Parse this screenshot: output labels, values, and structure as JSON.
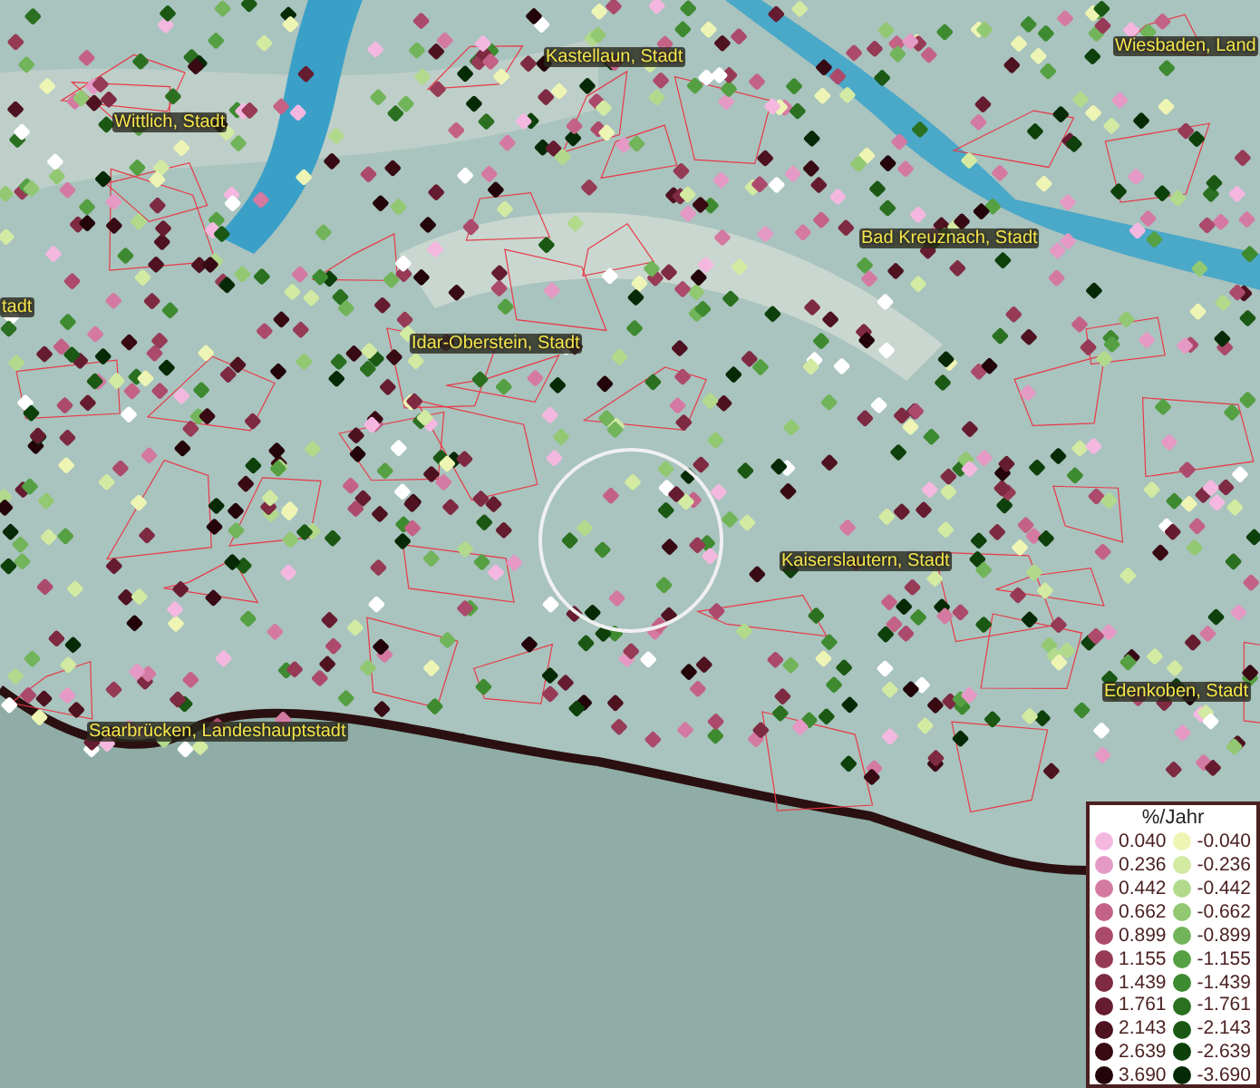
{
  "map": {
    "places": [
      {
        "name": "Kastellaun, Stadt"
      },
      {
        "name": "Wiesbaden, Land"
      },
      {
        "name": "Wittlich, Stadt"
      },
      {
        "name": "Bad Kreuznach, Stadt"
      },
      {
        "name": "tadt"
      },
      {
        "name": "Idar-Oberstein, Stadt"
      },
      {
        "name": "Kaiserslautern, Stadt"
      },
      {
        "name": "Edenkoben, Stadt"
      },
      {
        "name": "Saarbrücken, Landeshauptstadt"
      }
    ]
  },
  "legend": {
    "title": "%/Jahr",
    "rows": [
      {
        "positive": {
          "label": "0.040",
          "color": "#f4b8e0"
        },
        "negative": {
          "label": "-0.040",
          "color": "#eef5b4"
        }
      },
      {
        "positive": {
          "label": "0.236",
          "color": "#e49ac4"
        },
        "negative": {
          "label": "-0.236",
          "color": "#d2eaa2"
        }
      },
      {
        "positive": {
          "label": "0.442",
          "color": "#d47aa2"
        },
        "negative": {
          "label": "-0.442",
          "color": "#b2da8c"
        }
      },
      {
        "positive": {
          "label": "0.662",
          "color": "#c46286"
        },
        "negative": {
          "label": "-0.662",
          "color": "#92c872"
        }
      },
      {
        "positive": {
          "label": "0.899",
          "color": "#ac4a6c"
        },
        "negative": {
          "label": "-0.899",
          "color": "#72b45a"
        }
      },
      {
        "positive": {
          "label": "1.155",
          "color": "#963a56"
        },
        "negative": {
          "label": "-1.155",
          "color": "#55a042"
        }
      },
      {
        "positive": {
          "label": "1.439",
          "color": "#7e2a42"
        },
        "negative": {
          "label": "-1.439",
          "color": "#3e8a30"
        }
      },
      {
        "positive": {
          "label": "1.761",
          "color": "#661c30"
        },
        "negative": {
          "label": "-1.761",
          "color": "#2a7020"
        }
      },
      {
        "positive": {
          "label": "2.143",
          "color": "#4e1220"
        },
        "negative": {
          "label": "-2.143",
          "color": "#1a5814"
        }
      },
      {
        "positive": {
          "label": "2.639",
          "color": "#380a14"
        },
        "negative": {
          "label": "-2.639",
          "color": "#0e400c"
        }
      },
      {
        "positive": {
          "label": "3.690",
          "color": "#22040a"
        },
        "negative": {
          "label": "-3.690",
          "color": "#062a06"
        }
      }
    ]
  }
}
